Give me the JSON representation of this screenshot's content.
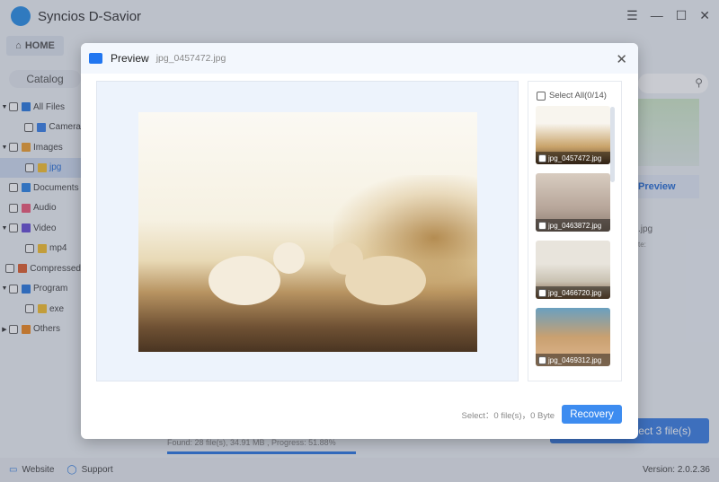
{
  "app": {
    "title": "Syncios D-Savior",
    "home": "HOME",
    "catalog": "Catalog",
    "tree": [
      {
        "label": "All Files",
        "level": 0,
        "arrow": "down",
        "color": "#2b7ae0"
      },
      {
        "label": "Camera",
        "level": 1,
        "arrow": "",
        "color": "#3b82e8"
      },
      {
        "label": "Images",
        "level": 0,
        "arrow": "down",
        "color": "#f0a030"
      },
      {
        "label": "jpg",
        "level": 1,
        "arrow": "",
        "color": "#f5c030",
        "selected": true
      },
      {
        "label": "Documents",
        "level": 0,
        "arrow": "",
        "color": "#2f86e6"
      },
      {
        "label": "Audio",
        "level": 0,
        "arrow": "",
        "color": "#ee5a7a"
      },
      {
        "label": "Video",
        "level": 0,
        "arrow": "down",
        "color": "#6a4fd6"
      },
      {
        "label": "mp4",
        "level": 1,
        "arrow": "",
        "color": "#f5c030"
      },
      {
        "label": "Compressed",
        "level": 0,
        "arrow": "",
        "color": "#e06030"
      },
      {
        "label": "Program",
        "level": 0,
        "arrow": "down",
        "color": "#2b7ae0"
      },
      {
        "label": "exe",
        "level": 1,
        "arrow": "",
        "color": "#f5c030"
      },
      {
        "label": "Others",
        "level": 0,
        "arrow": "right",
        "color": "#f08a20"
      }
    ],
    "right_preview": "Preview",
    "right_file": ".jpg",
    "right_date": "te:",
    "progress_text": "Found: 28 file(s), 34.91 MB , Progress: 51.88%",
    "progress": 51.88,
    "recover_btn": "elect 3 file(s)",
    "website": "Website",
    "support": "Support",
    "version": "Version: 2.0.2.36"
  },
  "modal": {
    "title": "Preview",
    "file": "jpg_0457472.jpg",
    "select_all": "Select All(0/14)",
    "thumbs": [
      "jpg_0457472.jpg",
      "jpg_0463872.jpg",
      "jpg_0466720.jpg",
      "jpg_0469312.jpg"
    ],
    "select_info": "Select：0 file(s)，0 Byte",
    "recovery": "Recovery"
  },
  "colors": {
    "accent": "#3d8cf0"
  }
}
